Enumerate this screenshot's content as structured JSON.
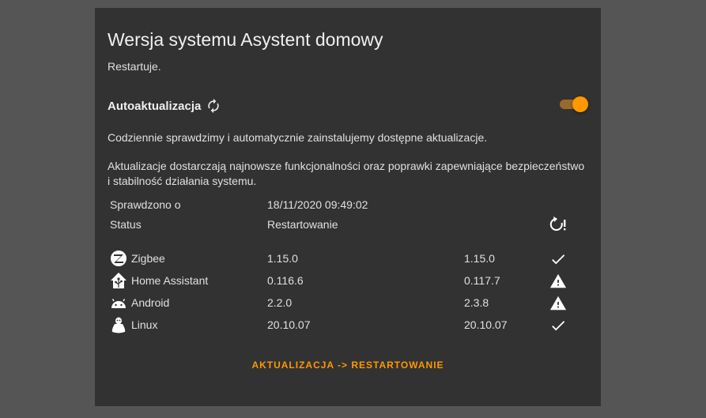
{
  "card": {
    "title": "Wersja systemu Asystent domowy",
    "subtitle": "Restartuje."
  },
  "auto_update": {
    "label": "Autoaktualizacja",
    "icon": "refresh-icon",
    "enabled": true,
    "accent_color": "#ff9800"
  },
  "description": {
    "p1": "Codziennie sprawdzimy i automatycznie zainstalujemy dostępne aktualizacje.",
    "p2": "Aktualizacje dostarczają najnowsze funkcjonalności oraz poprawki zapewniające bezpieczeństwo i stabilność działania systemu."
  },
  "info": {
    "checked_label": "Sprawdzono o",
    "checked_value": "18/11/2020 09:49:02",
    "status_label": "Status",
    "status_value": "Restartowanie",
    "status_icon": "restart-alert-icon"
  },
  "components": [
    {
      "name": "Zigbee",
      "icon": "zigbee-icon",
      "current": "1.15.0",
      "latest": "1.15.0",
      "state": "check-icon"
    },
    {
      "name": "Home Assistant",
      "icon": "home-assistant-icon",
      "current": "0.116.6",
      "latest": "0.117.7",
      "state": "warning-icon"
    },
    {
      "name": "Android",
      "icon": "android-icon",
      "current": "2.2.0",
      "latest": "2.3.8",
      "state": "warning-icon"
    },
    {
      "name": "Linux",
      "icon": "linux-icon",
      "current": "20.10.07",
      "latest": "20.10.07",
      "state": "check-icon"
    }
  ],
  "action": {
    "label": "AKTUALIZACJA -> RESTARTOWANIE"
  }
}
